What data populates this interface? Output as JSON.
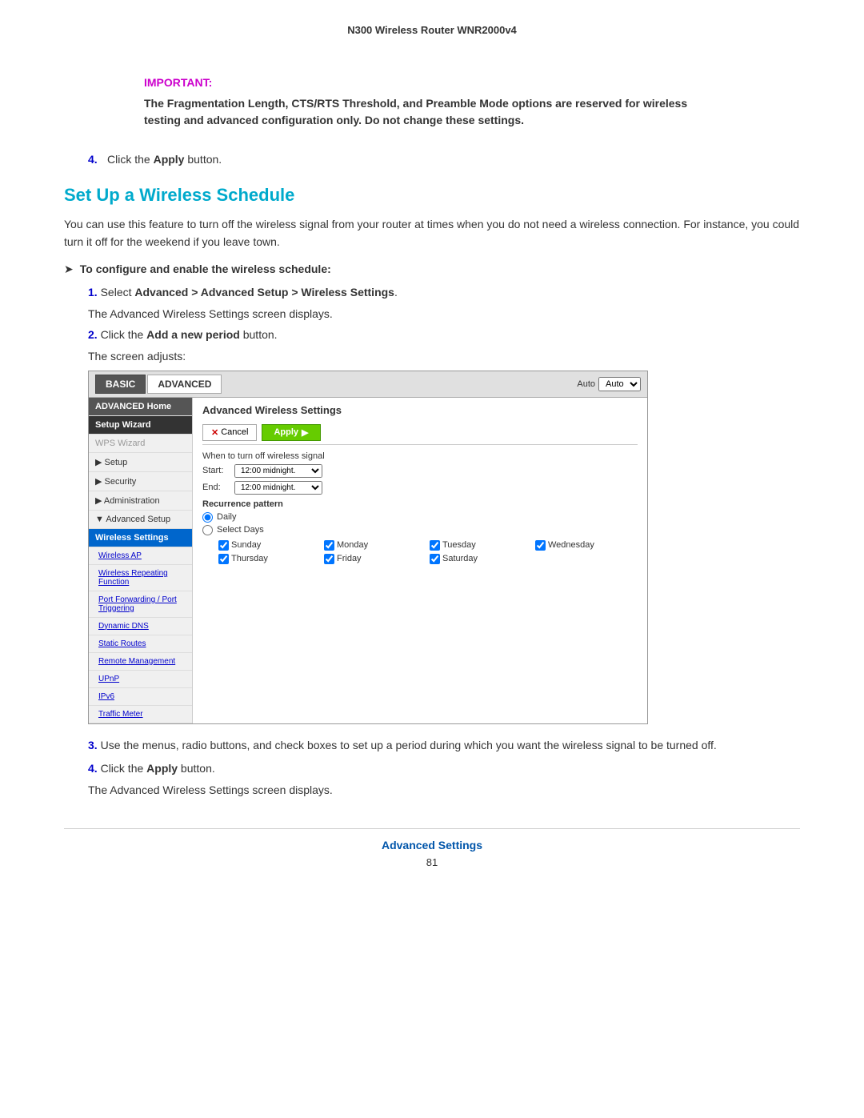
{
  "header": {
    "title": "N300 Wireless Router WNR2000v4"
  },
  "important": {
    "label": "IMPORTANT:",
    "text": "The Fragmentation Length, CTS/RTS Threshold, and Preamble Mode options are reserved for wireless testing and advanced configuration only. Do not change these settings."
  },
  "step4_apply": {
    "number": "4.",
    "text": "Click the ",
    "bold": "Apply",
    "rest": " button."
  },
  "section": {
    "title": "Set Up a Wireless Schedule",
    "body": "You can use this feature to turn off the wireless signal from your router at times when you do not need a wireless connection. For instance, you could turn it off for the weekend if you leave town."
  },
  "task": {
    "arrow": "➤",
    "label": "To configure and enable the wireless schedule:"
  },
  "substeps": {
    "step1_num": "1.",
    "step1_text": "Select ",
    "step1_bold": "Advanced > Advanced Setup > Wireless Settings",
    "step1_rest": ".",
    "step1_note": "The Advanced Wireless Settings screen displays.",
    "step2_num": "2.",
    "step2_text": "Click the ",
    "step2_bold": "Add a new period",
    "step2_rest": " button.",
    "step2_note": "The screen adjusts:",
    "step3_num": "3.",
    "step3_text": "Use the menus, radio buttons, and check boxes to set up a period during which you want the wireless signal to be turned off.",
    "step4_num": "4.",
    "step4_text": "Click the ",
    "step4_bold": "Apply",
    "step4_rest": " button.",
    "step4_note": "The Advanced Wireless Settings screen displays."
  },
  "router_ui": {
    "tab_basic": "BASIC",
    "tab_advanced": "ADVANCED",
    "tab_auto_label": "Auto",
    "sidebar": {
      "advanced_home": "ADVANCED Home",
      "setup_wizard": "Setup Wizard",
      "wps_wizard": "WPS Wizard",
      "setup": "▶ Setup",
      "security": "▶ Security",
      "administration": "▶ Administration",
      "advanced_setup": "▼ Advanced Setup",
      "wireless_settings": "Wireless Settings",
      "wireless_ap": "Wireless AP",
      "wireless_repeating": "Wireless Repeating Function",
      "port_forwarding": "Port Forwarding / Port Triggering",
      "dynamic_dns": "Dynamic DNS",
      "static_routes": "Static Routes",
      "remote_mgmt": "Remote Management",
      "upnp": "UPnP",
      "ipv6": "IPv6",
      "traffic_meter": "Traffic Meter"
    },
    "main": {
      "title": "Advanced Wireless Settings",
      "btn_cancel": "Cancel",
      "btn_apply": "Apply",
      "form_label": "When to turn off wireless signal",
      "start_label": "Start:",
      "start_value": "12:00 midnight.",
      "end_label": "End:",
      "end_value": "12:00 midnight.",
      "recurrence_title": "Recurrence pattern",
      "radio_daily": "Daily",
      "radio_select_days": "Select Days",
      "days": [
        "Sunday",
        "Monday",
        "Tuesday",
        "Wednesday",
        "Thursday",
        "Friday",
        "Saturday"
      ],
      "days_checked": [
        true,
        true,
        true,
        true,
        true,
        true,
        true
      ]
    }
  },
  "footer": {
    "title": "Advanced Settings",
    "page": "81"
  }
}
